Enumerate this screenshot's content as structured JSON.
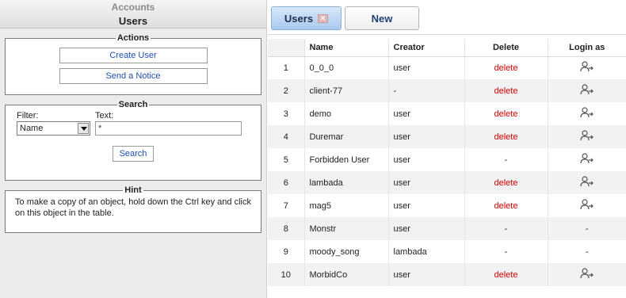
{
  "left": {
    "header_top": "Accounts",
    "header_title": "Users",
    "actions": {
      "legend": "Actions",
      "create_user": "Create User",
      "send_notice": "Send a Notice"
    },
    "search": {
      "legend": "Search",
      "filter_label": "Filter:",
      "text_label": "Text:",
      "filter_value": "Name",
      "text_value": "*",
      "button": "Search"
    },
    "hint": {
      "legend": "Hint",
      "text": "To make a copy of an object, hold down the Ctrl key and click on this object in the table."
    }
  },
  "tabs": [
    {
      "label": "Users",
      "active": true,
      "closable": true
    },
    {
      "label": "New",
      "active": false,
      "closable": false
    }
  ],
  "table": {
    "columns": [
      "",
      "Name",
      "Creator",
      "Delete",
      "Login as"
    ],
    "rows": [
      {
        "idx": "1",
        "name": "0_0_0",
        "creator": "user",
        "delete": "delete",
        "login": true
      },
      {
        "idx": "2",
        "name": "client-77",
        "creator": "-",
        "delete": "delete",
        "login": true
      },
      {
        "idx": "3",
        "name": "demo",
        "creator": "user",
        "delete": "delete",
        "login": true
      },
      {
        "idx": "4",
        "name": "Duremar",
        "creator": "user",
        "delete": "delete",
        "login": true
      },
      {
        "idx": "5",
        "name": "Forbidden User",
        "creator": "user",
        "delete": "-",
        "login": true
      },
      {
        "idx": "6",
        "name": "lambada",
        "creator": "user",
        "delete": "delete",
        "login": true
      },
      {
        "idx": "7",
        "name": "mag5",
        "creator": "user",
        "delete": "delete",
        "login": true
      },
      {
        "idx": "8",
        "name": "Monstr",
        "creator": "user",
        "delete": "-",
        "login": false,
        "login_text": "-"
      },
      {
        "idx": "9",
        "name": "moody_song",
        "creator": "lambada",
        "delete": "-",
        "login": false,
        "login_text": "-"
      },
      {
        "idx": "10",
        "name": "MorbidCo",
        "creator": "user",
        "delete": "delete",
        "login": true
      }
    ]
  },
  "colors": {
    "delete_link": "#d40000",
    "link": "#1f4fb0",
    "active_tab": "#a9c9ef"
  },
  "icons": {
    "login_as": "user-login-icon",
    "tab_close": "close-icon",
    "select_arrow": "chevron-down-icon"
  }
}
